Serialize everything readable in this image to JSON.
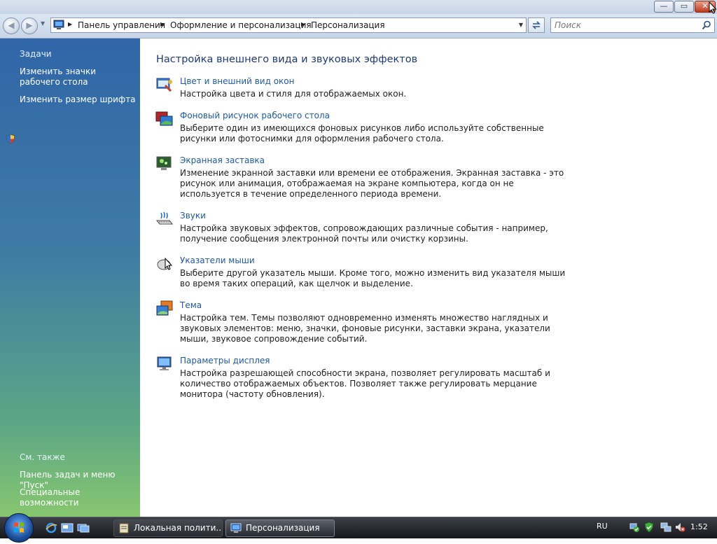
{
  "window": {
    "caption_min": "—",
    "caption_max": "▭",
    "caption_close": "✕"
  },
  "address": {
    "crumbs": [
      "Панель управления",
      "Оформление и персонализация",
      "Персонализация"
    ],
    "search_placeholder": "Поиск"
  },
  "sidebar": {
    "tasks_heading": "Задачи",
    "tasks": [
      "Изменить значки рабочего стола",
      "Изменить размер шрифта"
    ],
    "see_also_heading": "См. также",
    "see_also": [
      "Панель задач и меню \"Пуск\"",
      "Специальные возможности"
    ]
  },
  "main": {
    "title": "Настройка внешнего вида и звуковых эффектов",
    "entries": [
      {
        "link": "Цвет и внешний вид окон",
        "desc": "Настройка цвета и стиля для отображаемых окон.",
        "icon": "window-color-icon"
      },
      {
        "link": "Фоновый рисунок рабочего стола",
        "desc": "Выберите один из имеющихся фоновых рисунков либо используйте собственные рисунки или фотоснимки для оформления рабочего стола.",
        "icon": "desktop-background-icon"
      },
      {
        "link": "Экранная заставка",
        "desc": "Изменение экранной заставки или времени ее отображения. Экранная заставка - это рисунок или анимация, отображаемая на экране компьютера, когда он не используется в течение определенного периода времени.",
        "icon": "screensaver-icon"
      },
      {
        "link": "Звуки",
        "desc": "Настройка звуковых эффектов, сопровождающих различные события - например, получение сообщения электронной почты или очистку корзины.",
        "icon": "sounds-icon"
      },
      {
        "link": "Указатели мыши",
        "desc": "Выберите другой указатель мыши. Кроме того, можно изменить вид указателя мыши во время таких операций, как щелчок и выделение.",
        "icon": "mouse-pointer-icon"
      },
      {
        "link": "Тема",
        "desc": "Настройка тем. Темы позволяют одновременно изменять множество наглядных и звуковых элементов: меню, значки, фоновые рисунки, заставки экрана, указатели мыши, звуковое сопровождение событий.",
        "icon": "theme-icon"
      },
      {
        "link": "Параметры дисплея",
        "desc": "Настройка разрешающей способности экрана, позволяет регулировать масштаб и количество отображаемых объектов. Позволяет также регулировать мерцание монитора (частоту обновления).",
        "icon": "display-settings-icon"
      }
    ]
  },
  "taskbar": {
    "tasks": [
      "Локальная полити...",
      "Персонализация"
    ],
    "language": "RU",
    "clock": "1:52"
  }
}
